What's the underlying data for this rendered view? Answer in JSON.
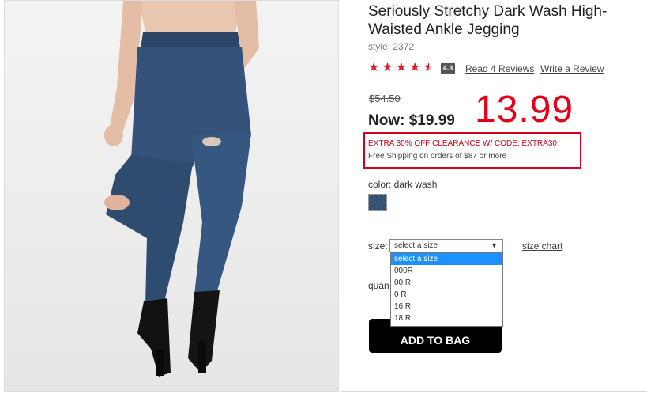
{
  "product": {
    "title": "Seriously Stretchy Dark Wash High-Waisted Ankle Jegging",
    "style_code": "style: 2372",
    "rating_badge": "4.3",
    "reviews_link": "Read 4 Reviews",
    "write_review_link": "Write a Review"
  },
  "pricing": {
    "was_price": "$54.50",
    "now_price": "Now: $19.99",
    "annotated_price": "13.99",
    "promo_text": "EXTRA 30% OFF CLEARANCE W/ CODE: EXTRA30",
    "shipping_text": "Free Shipping on orders of $87 or more"
  },
  "color": {
    "label": "color: dark wash",
    "swatch_color": "#3f5d82"
  },
  "size": {
    "label": "size:",
    "selected": "select a size",
    "chart_link": "size chart",
    "options": [
      "select a size",
      "000R",
      "00 R",
      "0 R",
      "16 R",
      "18 R"
    ]
  },
  "quantity": {
    "label_partial": "quan"
  },
  "actions": {
    "add_to_bag": "ADD TO BAG"
  },
  "colors": {
    "accent_red": "#d0021b",
    "annotation_red": "#e2001a",
    "star_red": "#d8232a",
    "selected_option": "#1e90ff"
  }
}
